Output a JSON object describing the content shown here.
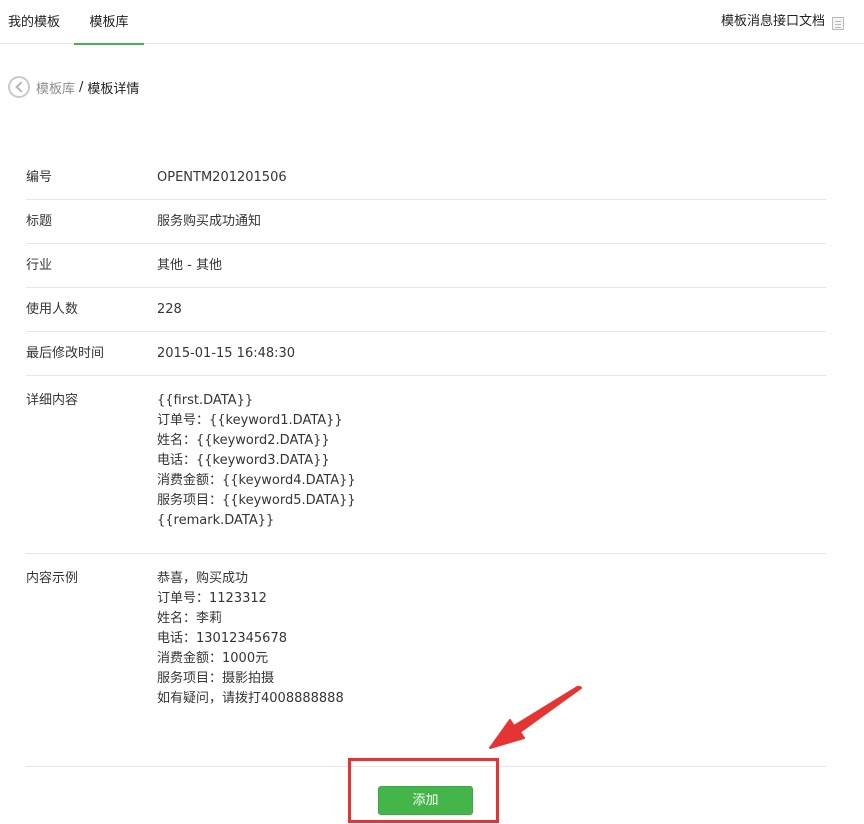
{
  "tabs": [
    {
      "label": "我的模板"
    },
    {
      "label": "模板库"
    }
  ],
  "doc_link": "模板消息接口文档",
  "breadcrumb": {
    "parent": "模板库",
    "separator": "/",
    "current": "模板详情"
  },
  "details": {
    "id": {
      "label": "编号",
      "value": "OPENTM201201506"
    },
    "title": {
      "label": "标题",
      "value": "服务购买成功通知"
    },
    "industry": {
      "label": "行业",
      "value": "其他 - 其他"
    },
    "users": {
      "label": "使用人数",
      "value": "228"
    },
    "modified": {
      "label": "最后修改时间",
      "value": "2015-01-15 16:48:30"
    },
    "content": {
      "label": "详细内容",
      "lines": [
        "{{first.DATA}}",
        "订单号：{{keyword1.DATA}}",
        "姓名：{{keyword2.DATA}}",
        "电话：{{keyword3.DATA}}",
        "消费金额：{{keyword4.DATA}}",
        "服务项目：{{keyword5.DATA}}",
        "{{remark.DATA}}"
      ]
    },
    "example": {
      "label": "内容示例",
      "lines": [
        "恭喜，购买成功",
        "订单号：1123312",
        "姓名：李莉",
        "电话：13012345678",
        "消费金额：1000元",
        "服务项目：摄影拍摄",
        "如有疑问，请拨打4008888888"
      ]
    }
  },
  "add_button": "添加",
  "colors": {
    "accent": "#44b549",
    "highlight": "#e63333"
  }
}
